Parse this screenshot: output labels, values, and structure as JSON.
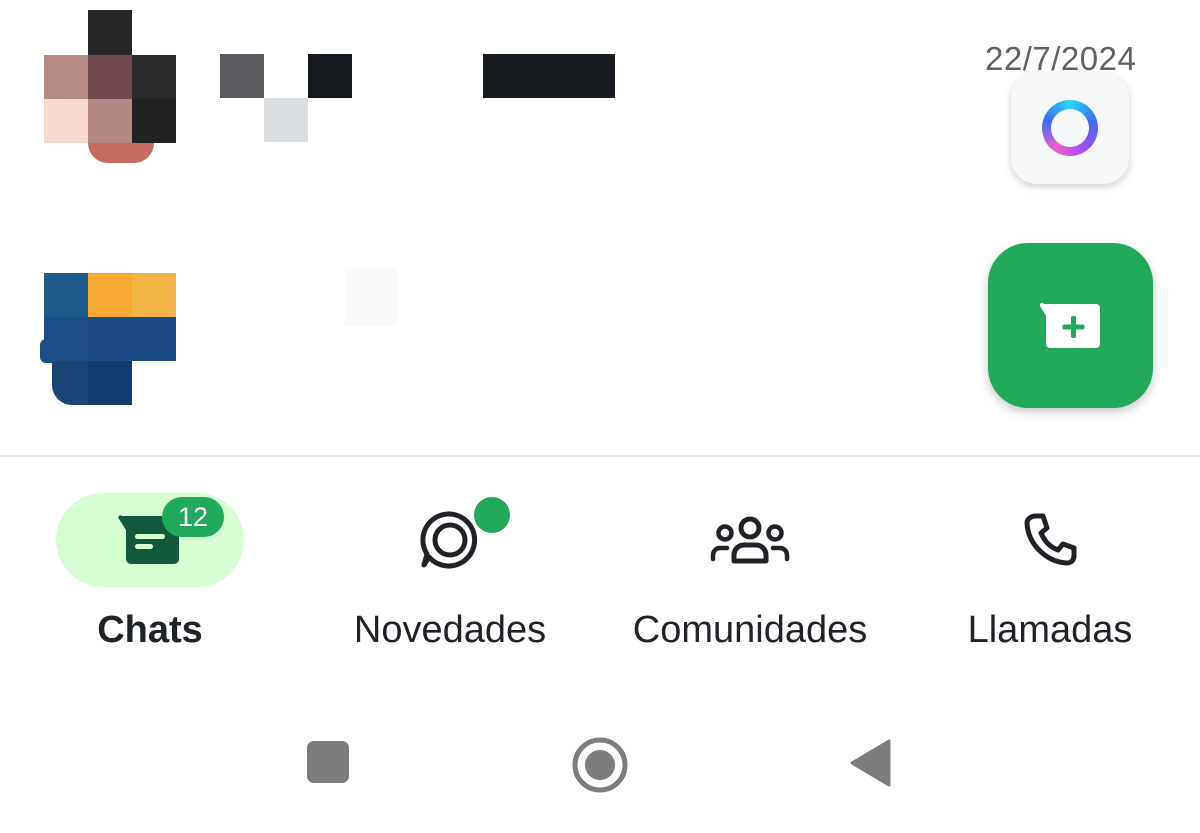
{
  "chat_list": {
    "items": [
      {
        "date": "22/7/2024"
      }
    ]
  },
  "fabs": {
    "meta_ai_icon": "meta-ai-ring-icon",
    "new_chat_icon": "new-chat-icon"
  },
  "bottom_nav": {
    "items": [
      {
        "label": "Chats",
        "badge": "12",
        "active": true,
        "icon": "chat-icon"
      },
      {
        "label": "Novedades",
        "dot": true,
        "icon": "status-icon"
      },
      {
        "label": "Comunidades",
        "icon": "communities-icon"
      },
      {
        "label": "Llamadas",
        "icon": "phone-icon"
      }
    ]
  },
  "colors": {
    "accent": "#21a95b",
    "active_pill": "#d7fdd3",
    "text": "#1f2328"
  }
}
